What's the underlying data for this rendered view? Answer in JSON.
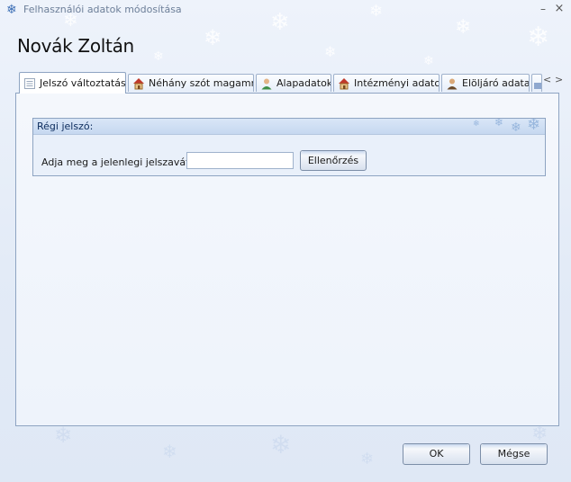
{
  "window": {
    "title": "Felhasználói adatok módosítása",
    "minimize_glyph": "–",
    "close_glyph": "×"
  },
  "header": {
    "user_name": "Novák Zoltán"
  },
  "tabs": [
    {
      "label": "Jelszó változtatása",
      "icon": "list-icon",
      "active": true
    },
    {
      "label": "Néhány szót magamról",
      "icon": "house-icon",
      "active": false
    },
    {
      "label": "Alapadatok",
      "icon": "user-icon",
      "active": false
    },
    {
      "label": "Intézményi adatok",
      "icon": "house-icon",
      "active": false
    },
    {
      "label": "Elöljáró adatai",
      "icon": "person-icon",
      "active": false
    },
    {
      "label": "",
      "icon": "partial-tab-icon",
      "active": false
    }
  ],
  "tab_scroll": {
    "left": "<",
    "right": ">"
  },
  "old_password": {
    "group_title": "Régi jelszó:",
    "prompt": "Adja meg a jelenlegi jelszavát:",
    "input_value": "",
    "check_button": "Ellenőrzés"
  },
  "footer": {
    "ok_label": "OK",
    "cancel_label": "Mégse"
  },
  "colors": {
    "accent": "#8ea4c2",
    "background": "#e3ebf7",
    "title_text": "#6d7f99"
  }
}
